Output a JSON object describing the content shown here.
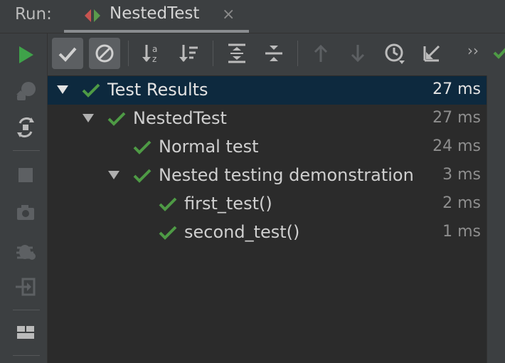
{
  "header": {
    "run_label": "Run:",
    "tab_title": "NestedTest",
    "tab_close": "×"
  },
  "toolbar": {
    "more": "››"
  },
  "colors": {
    "pass_green": "#4e9a45",
    "run_green": "#3fa24a",
    "selection": "#0d293e",
    "panel": "#3c3f41",
    "tree_bg": "#2b2b2b"
  },
  "tree": {
    "rows": [
      {
        "label": "Test Results",
        "duration": "27 ms",
        "expanded": true,
        "status": "passed",
        "selected": true
      },
      {
        "label": "NestedTest",
        "duration": "27 ms",
        "expanded": true,
        "status": "passed"
      },
      {
        "label": "Normal test",
        "duration": "24 ms",
        "status": "passed"
      },
      {
        "label": "Nested testing demonstration",
        "duration": "3 ms",
        "expanded": true,
        "status": "passed"
      },
      {
        "label": "first_test()",
        "duration": "2 ms",
        "status": "passed"
      },
      {
        "label": "second_test()",
        "duration": "1 ms",
        "status": "passed"
      }
    ]
  }
}
